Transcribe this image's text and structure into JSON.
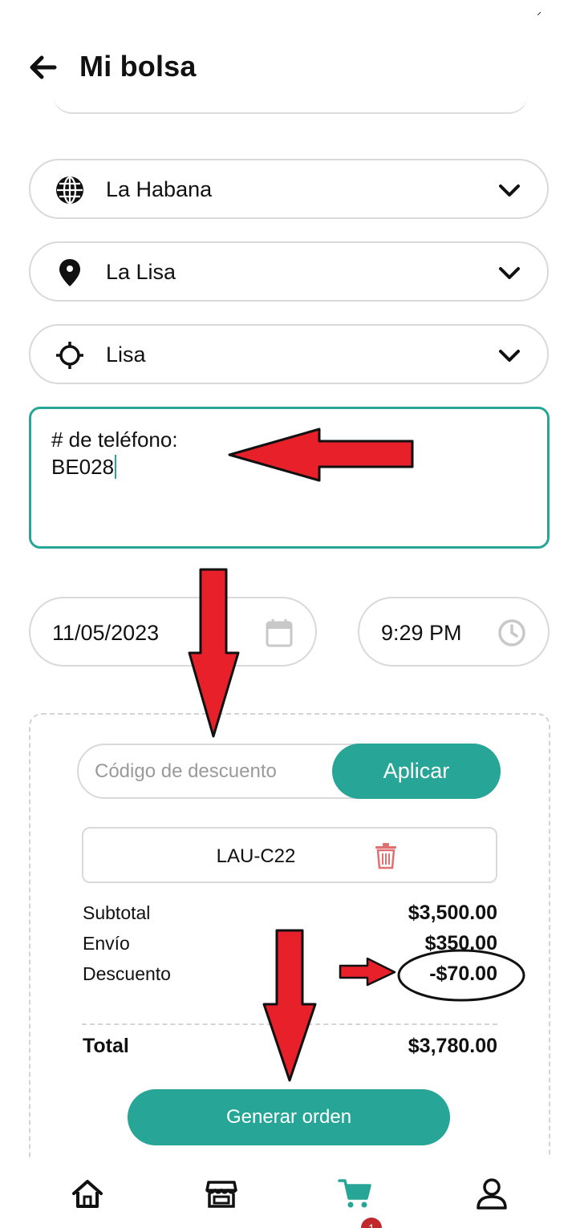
{
  "header": {
    "title": "Mi bolsa",
    "back_icon": "arrow-left-icon"
  },
  "location": {
    "province": {
      "label": "La Habana",
      "icon": "globe-icon"
    },
    "municipality": {
      "label": "La Lisa",
      "icon": "map-pin-icon"
    },
    "neighborhood": {
      "label": "Lisa",
      "icon": "crosshair-icon"
    }
  },
  "phone": {
    "label": "# de teléfono:",
    "value": "BE028"
  },
  "schedule": {
    "date": "11/05/2023",
    "time": "9:29 PM"
  },
  "coupon": {
    "placeholder": "Código de descuento",
    "apply_label": "Aplicar",
    "applied_code": "LAU-C22"
  },
  "summary": {
    "subtotal_label": "Subtotal",
    "subtotal_value": "$3,500.00",
    "shipping_label": "Envío",
    "shipping_value": "$350.00",
    "discount_label": "Descuento",
    "discount_value": "-$70.00",
    "total_label": "Total",
    "total_value": "$3,780.00"
  },
  "actions": {
    "generate_label": "Generar orden"
  },
  "bottom_nav": {
    "items": [
      "home-icon",
      "store-icon",
      "cart-icon",
      "user-icon"
    ],
    "cart_badge": "1"
  },
  "colors": {
    "accent": "#27a596",
    "badge": "#c0282c",
    "annotation_arrow": "#e8202a",
    "trash": "#e07070"
  }
}
